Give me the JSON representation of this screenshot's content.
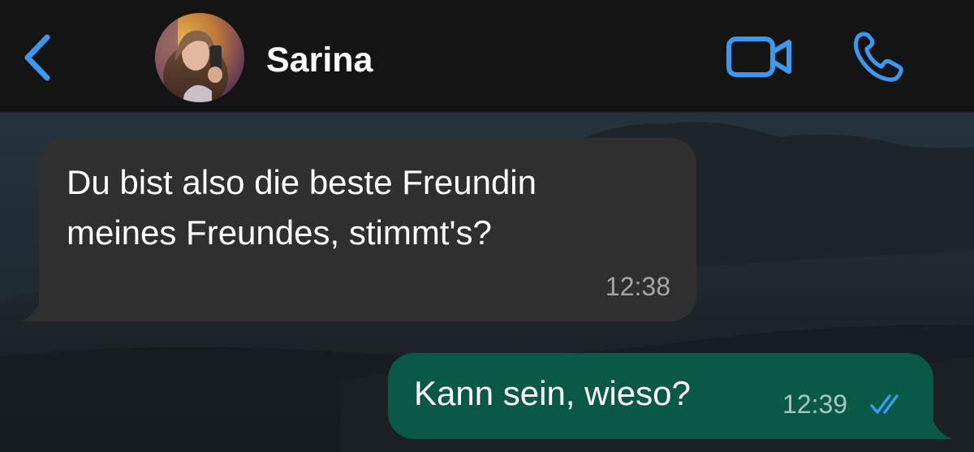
{
  "header": {
    "contact_name": "Sarina",
    "back_icon": "chevron-left-icon",
    "video_icon": "video-camera-icon",
    "call_icon": "phone-icon",
    "accent_color": "#3b99f0"
  },
  "messages": [
    {
      "direction": "incoming",
      "text": "Du bist also die beste Freundin\nmeines Freundes, stimmt's?",
      "time": "12:38"
    },
    {
      "direction": "outgoing",
      "text": "Kann sein, wieso?",
      "time": "12:39",
      "status": "read",
      "status_icon": "double-check-icon"
    }
  ],
  "colors": {
    "header_bg": "#141414",
    "incoming_bubble": "#2f2f30",
    "outgoing_bubble": "#0a5846",
    "read_ticks": "#3b99f0"
  }
}
